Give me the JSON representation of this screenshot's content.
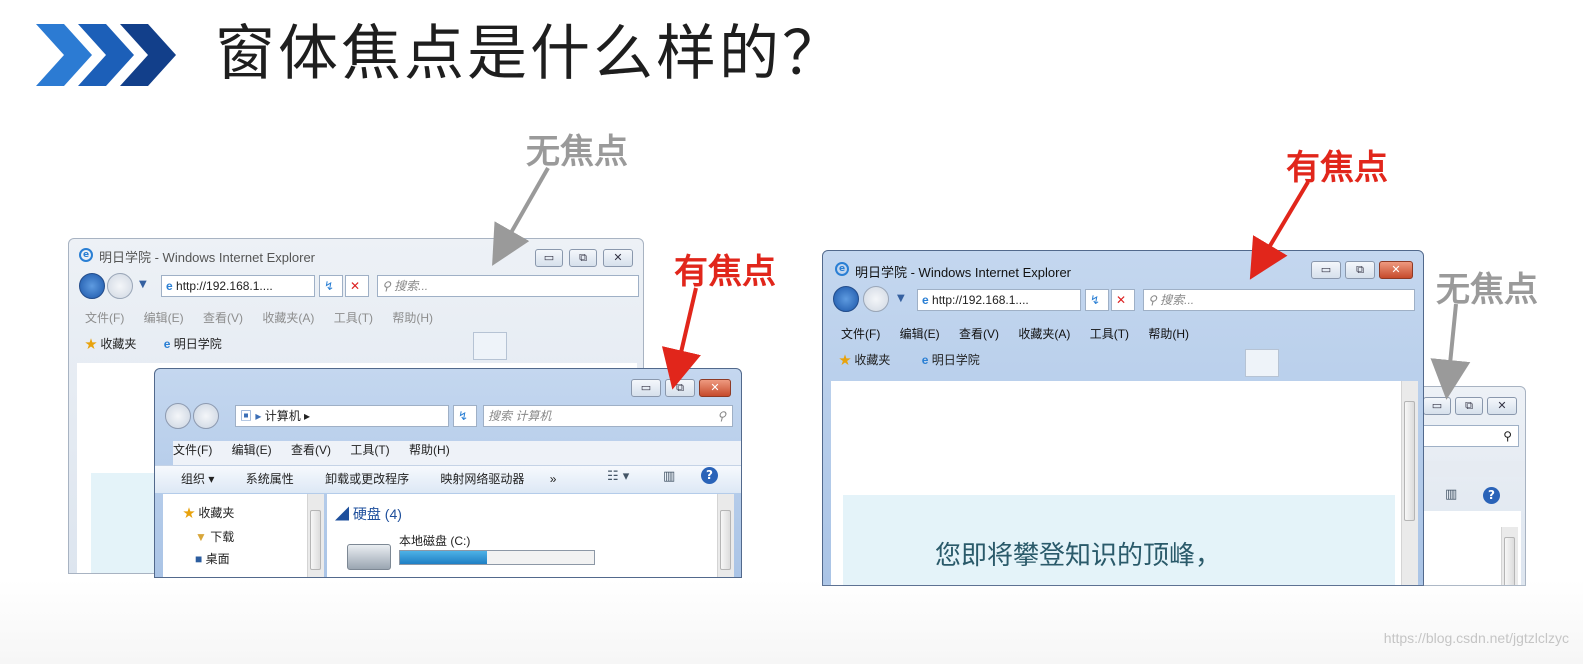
{
  "slide": {
    "title": "窗体焦点是什么样的？",
    "watermark": "https://blog.csdn.net/jgtzlclzyc"
  },
  "labels": {
    "left_unfocused": "无焦点",
    "left_focused": "有焦点",
    "right_focused": "有焦点",
    "right_unfocused": "无焦点"
  },
  "ie_left": {
    "title": "明日学院 - Windows Internet Explorer",
    "address": "http://192.168.1....",
    "search_placeholder": "搜索...",
    "menu": [
      "文件(F)",
      "编辑(E)",
      "查看(V)",
      "收藏夹(A)",
      "工具(T)",
      "帮助(H)"
    ],
    "favorites": "收藏夹",
    "tab": "明日学院"
  },
  "explorer_left": {
    "path": "计算机",
    "search_placeholder": "搜索 计算机",
    "menu": [
      "文件(F)",
      "编辑(E)",
      "查看(V)",
      "工具(T)",
      "帮助(H)"
    ],
    "commands": [
      "组织 ▾",
      "系统属性",
      "卸载或更改程序",
      "映射网络驱动器",
      "»"
    ],
    "nav": [
      "收藏夹",
      "下载",
      "桌面"
    ],
    "group_header": "硬盘 (4)",
    "drive_name": "本地磁盘 (C:)",
    "drive_usage": 0.45
  },
  "ie_right": {
    "title": "明日学院 - Windows Internet Explorer",
    "address": "http://192.168.1....",
    "search_placeholder": "搜索...",
    "menu": [
      "文件(F)",
      "编辑(E)",
      "查看(V)",
      "收藏夹(A)",
      "工具(T)",
      "帮助(H)"
    ],
    "favorites": "收藏夹",
    "tab": "明日学院",
    "page_text": "您即将攀登知识的顶峰，"
  },
  "colors": {
    "accent_red": "#e1261b",
    "label_gray": "#9a9a9a",
    "chevron_blue": "#1c5fb8"
  }
}
